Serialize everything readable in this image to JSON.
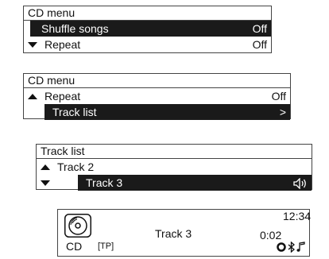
{
  "panels": [
    {
      "title": "CD menu",
      "rows": [
        {
          "label": "Shuffle songs",
          "value": "Off",
          "arrow": "none",
          "selected": true
        },
        {
          "label": "Repeat",
          "value": "Off",
          "arrow": "down",
          "selected": false
        }
      ]
    },
    {
      "title": "CD menu",
      "rows": [
        {
          "label": "Repeat",
          "value": "Off",
          "arrow": "up",
          "selected": false
        },
        {
          "label": "Track list",
          "value": ">",
          "arrow": "none",
          "selected": true
        }
      ]
    },
    {
      "title": "Track list",
      "rows": [
        {
          "label": "Track 2",
          "value": "",
          "arrow": "up",
          "selected": false
        },
        {
          "label": "Track 3",
          "value": "",
          "arrow": "down",
          "selected": true,
          "icon": "speaker-icon"
        }
      ]
    }
  ],
  "now_playing": {
    "icon": "disc-icon",
    "source": "CD",
    "tp": "[TP]",
    "track": "Track 3",
    "elapsed": "0:02",
    "clock": "12:34",
    "status_icons": [
      "circle-icon",
      "bluetooth-icon",
      "music-note-icon"
    ]
  },
  "colors": {
    "selected_bg": "#1a1a1a",
    "selected_text": "#ffffff",
    "border": "#444444"
  }
}
